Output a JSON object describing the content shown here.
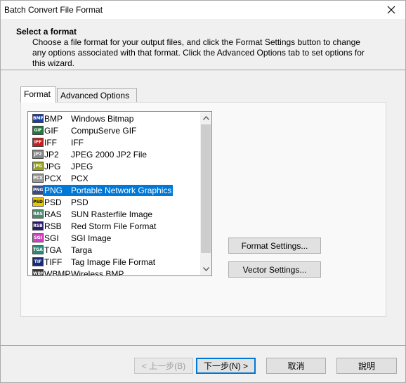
{
  "window": {
    "title": "Batch Convert File Format"
  },
  "header": {
    "title": "Select a format",
    "description": "Choose a file format for your output files, and click the Format Settings button to change any options associated with that format. Click the Advanced Options tab to set options for this wizard."
  },
  "tabs": [
    {
      "label": "Format",
      "active": true
    },
    {
      "label": "Advanced Options",
      "active": false
    }
  ],
  "formats": [
    {
      "ext": "BMP",
      "desc": "Windows Bitmap",
      "icon": "BMP",
      "icon_color": "#1e3fa8"
    },
    {
      "ext": "GIF",
      "desc": "CompuServe GIF",
      "icon": "GIF",
      "icon_color": "#1f7a3a"
    },
    {
      "ext": "IFF",
      "desc": "IFF",
      "icon": "IFF",
      "icon_color": "#c81e1e"
    },
    {
      "ext": "JP2",
      "desc": "JPEG 2000 JP2 File",
      "icon": "JP2",
      "icon_color": "#8a8a8a"
    },
    {
      "ext": "JPG",
      "desc": "JPEG",
      "icon": "JPG",
      "icon_color": "#9aa418"
    },
    {
      "ext": "PCX",
      "desc": "PCX",
      "icon": "PCX",
      "icon_color": "#9a9a9a"
    },
    {
      "ext": "PNG",
      "desc": "Portable Network Graphics",
      "icon": "PNG",
      "icon_color": "#3a4a8a",
      "selected": true
    },
    {
      "ext": "PSD",
      "desc": "PSD",
      "icon": "PSD",
      "icon_color": "#e8c800"
    },
    {
      "ext": "RAS",
      "desc": "SUN Rasterfile Image",
      "icon": "RAS",
      "icon_color": "#4a8a6a"
    },
    {
      "ext": "RSB",
      "desc": "Red Storm File Format",
      "icon": "RSB",
      "icon_color": "#2a1a6a"
    },
    {
      "ext": "SGI",
      "desc": "SGI Image",
      "icon": "SGI",
      "icon_color": "#d040c0"
    },
    {
      "ext": "TGA",
      "desc": "Targa",
      "icon": "TGA",
      "icon_color": "#2a8a7a"
    },
    {
      "ext": "TIFF",
      "desc": "Tag Image File Format",
      "icon": "TIF",
      "icon_color": "#1a2a7a"
    },
    {
      "ext": "WBMP",
      "desc": "Wireless BMP",
      "icon": "WBMP",
      "icon_color": "#333333"
    }
  ],
  "buttons": {
    "format_settings": "Format Settings...",
    "vector_settings": "Vector Settings...",
    "back": "< 上一步(B)",
    "next": "下一步(N) >",
    "cancel": "取消",
    "help": "說明"
  },
  "colors": {
    "selection": "#0078d7",
    "default_button_border": "#0078d7"
  }
}
